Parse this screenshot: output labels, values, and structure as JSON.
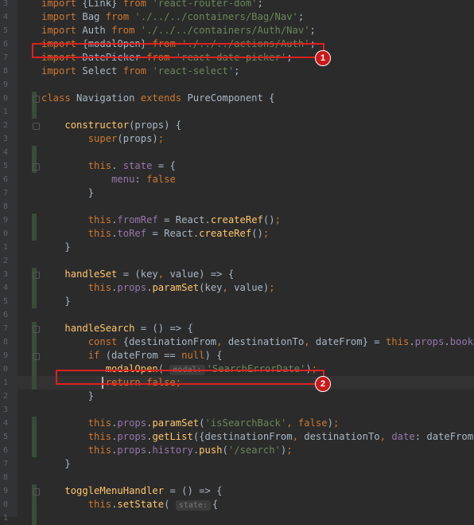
{
  "editor": {
    "language": "javascript",
    "line_numbers": [
      "3",
      "4",
      "5",
      "6",
      "7",
      "8",
      "9",
      "0",
      "1",
      "2",
      "3",
      "4",
      "5",
      "6",
      "7",
      "8",
      "9",
      "0",
      "1",
      "2",
      "3",
      "4",
      "5",
      "6",
      "7",
      "8",
      "9",
      "0",
      "1",
      "2",
      "3",
      "4",
      "5",
      "6",
      "7",
      "8",
      "9",
      "0",
      "1"
    ],
    "lines": [
      [
        [
          "kw",
          "import "
        ],
        [
          "",
          "{Link} "
        ],
        [
          "kw",
          "from "
        ],
        [
          "str",
          "'react-router-dom'"
        ],
        [
          "",
          ";"
        ]
      ],
      [
        [
          "kw",
          "import "
        ],
        [
          "",
          "Bag "
        ],
        [
          "kw",
          "from "
        ],
        [
          "str",
          "'./../../containers/Bag/Nav'"
        ],
        [
          "",
          ";"
        ]
      ],
      [
        [
          "kw",
          "import "
        ],
        [
          "",
          "Auth "
        ],
        [
          "kw",
          "from "
        ],
        [
          "str",
          "'./../../containers/Auth/Nav'"
        ],
        [
          "",
          ";"
        ]
      ],
      [
        [
          "kw",
          "import "
        ],
        [
          "",
          "{modalOpen} "
        ],
        [
          "kw",
          "from "
        ],
        [
          "str",
          "'./../../actions/Auth'"
        ],
        [
          "",
          ";"
        ]
      ],
      [
        [
          "kw",
          "import "
        ],
        [
          "",
          "DatePicker "
        ],
        [
          "kw",
          "from "
        ],
        [
          "str",
          "'react-date-picker'"
        ],
        [
          "",
          ";"
        ]
      ],
      [
        [
          "kw",
          "import "
        ],
        [
          "",
          "Select "
        ],
        [
          "kw",
          "from "
        ],
        [
          "str",
          "'react-select'"
        ],
        [
          "",
          ";"
        ]
      ],
      [],
      [
        [
          "kw",
          "class "
        ],
        [
          "",
          "Navigation "
        ],
        [
          "kw",
          "extends "
        ],
        [
          "",
          "PureComponent {"
        ]
      ],
      [],
      [
        [
          "",
          "    "
        ],
        [
          "fn",
          "constructor"
        ],
        [
          "",
          "(props) {"
        ]
      ],
      [
        [
          "",
          "        "
        ],
        [
          "kw",
          "super"
        ],
        [
          "",
          "(props)"
        ],
        [
          "kw",
          ";"
        ]
      ],
      [],
      [
        [
          "",
          "        "
        ],
        [
          "kw",
          "this"
        ],
        [
          "",
          ". "
        ],
        [
          "prop",
          "state"
        ],
        [
          "",
          " = {"
        ]
      ],
      [
        [
          "",
          "            "
        ],
        [
          "prop",
          "menu"
        ],
        [
          "",
          ": "
        ],
        [
          "kw",
          "false"
        ]
      ],
      [
        [
          "",
          "        }"
        ]
      ],
      [],
      [
        [
          "",
          "        "
        ],
        [
          "kw",
          "this"
        ],
        [
          "",
          "."
        ],
        [
          "prop",
          "fromRef"
        ],
        [
          "",
          " = React."
        ],
        [
          "fn",
          "createRef"
        ],
        [
          "",
          "()"
        ],
        [
          "kw",
          ";"
        ]
      ],
      [
        [
          "",
          "        "
        ],
        [
          "kw",
          "this"
        ],
        [
          "",
          "."
        ],
        [
          "prop",
          "toRef"
        ],
        [
          "",
          " = React."
        ],
        [
          "fn",
          "createRef"
        ],
        [
          "",
          "()"
        ],
        [
          "kw",
          ";"
        ]
      ],
      [
        [
          "",
          "    }"
        ]
      ],
      [],
      [
        [
          "",
          "    "
        ],
        [
          "fn",
          "handleSet"
        ],
        [
          "",
          " = (key"
        ],
        [
          "kw",
          ","
        ],
        [
          "",
          " value) => {"
        ]
      ],
      [
        [
          "",
          "        "
        ],
        [
          "kw",
          "this"
        ],
        [
          "",
          "."
        ],
        [
          "prop",
          "props"
        ],
        [
          "",
          "."
        ],
        [
          "fn",
          "paramSet"
        ],
        [
          "",
          "(key"
        ],
        [
          "kw",
          ","
        ],
        [
          "",
          " value)"
        ],
        [
          "kw",
          ";"
        ]
      ],
      [
        [
          "",
          "    }"
        ]
      ],
      [],
      [
        [
          "",
          "    "
        ],
        [
          "fn",
          "handleSearch"
        ],
        [
          "",
          " = () => {"
        ]
      ],
      [
        [
          "",
          "        "
        ],
        [
          "kw",
          "const "
        ],
        [
          "",
          "{destinationFrom"
        ],
        [
          "kw",
          ","
        ],
        [
          "",
          " destinationTo"
        ],
        [
          "kw",
          ","
        ],
        [
          "",
          " dateFrom} = "
        ],
        [
          "kw",
          "this"
        ],
        [
          "",
          "."
        ],
        [
          "prop",
          "props"
        ],
        [
          "",
          "."
        ],
        [
          "prop",
          "booking"
        ],
        [
          "kw",
          ";"
        ]
      ],
      [
        [
          "",
          "        "
        ],
        [
          "kw",
          "if "
        ],
        [
          "",
          "(dateFrom == "
        ],
        [
          "kw",
          "null"
        ],
        [
          "",
          ") {"
        ]
      ],
      [
        [
          "",
          "           "
        ],
        [
          "fn",
          "modalOpen"
        ],
        [
          "",
          "( "
        ],
        [
          "hint",
          "modal:"
        ],
        [
          "str",
          "'SearchErrorDate'"
        ],
        [
          "",
          ")"
        ],
        [
          "kw",
          ";"
        ]
      ],
      [
        [
          "",
          "           "
        ],
        [
          "kw",
          "return false"
        ],
        [
          "kw",
          ";"
        ]
      ],
      [
        [
          "",
          "        }"
        ]
      ],
      [],
      [
        [
          "",
          "        "
        ],
        [
          "kw",
          "this"
        ],
        [
          "",
          "."
        ],
        [
          "prop",
          "props"
        ],
        [
          "",
          "."
        ],
        [
          "fn",
          "paramSet"
        ],
        [
          "",
          "("
        ],
        [
          "str",
          "'isSearchBack'"
        ],
        [
          "kw",
          ","
        ],
        [
          "",
          " "
        ],
        [
          "kw",
          "false"
        ],
        [
          "",
          ")"
        ],
        [
          "kw",
          ";"
        ]
      ],
      [
        [
          "",
          "        "
        ],
        [
          "kw",
          "this"
        ],
        [
          "",
          "."
        ],
        [
          "prop",
          "props"
        ],
        [
          "",
          "."
        ],
        [
          "fn",
          "getList"
        ],
        [
          "",
          "({destinationFrom"
        ],
        [
          "kw",
          ","
        ],
        [
          "",
          " destinationTo"
        ],
        [
          "kw",
          ","
        ],
        [
          "",
          " "
        ],
        [
          "prop",
          "date"
        ],
        [
          "",
          ": dateFrom})"
        ],
        [
          "kw",
          ";"
        ]
      ],
      [
        [
          "",
          "        "
        ],
        [
          "kw",
          "this"
        ],
        [
          "",
          "."
        ],
        [
          "prop",
          "props"
        ],
        [
          "",
          "."
        ],
        [
          "prop",
          "history"
        ],
        [
          "",
          "."
        ],
        [
          "fn",
          "push"
        ],
        [
          "",
          "("
        ],
        [
          "str",
          "'/search'"
        ],
        [
          "",
          ")"
        ],
        [
          "kw",
          ";"
        ]
      ],
      [
        [
          "",
          "    }"
        ]
      ],
      [],
      [
        [
          "",
          "    "
        ],
        [
          "fn",
          "toggleMenuHandler"
        ],
        [
          "",
          " = () => {"
        ]
      ],
      [
        [
          "",
          "        "
        ],
        [
          "kw",
          "this"
        ],
        [
          "",
          "."
        ],
        [
          "fn",
          "setState"
        ],
        [
          "",
          "( "
        ],
        [
          "hint",
          "state:"
        ],
        [
          "",
          "{"
        ]
      ],
      []
    ],
    "current_line_index": 28
  },
  "annotations": [
    {
      "label": "1",
      "target": "import-modalOpen-line"
    },
    {
      "label": "2",
      "target": "modalOpen-call-line"
    }
  ],
  "colors": {
    "background": "#2b2b2b",
    "keyword": "#cc7832",
    "string": "#6a8759",
    "function": "#ffc66d",
    "property": "#9876aa",
    "annotation": "#e02020"
  }
}
